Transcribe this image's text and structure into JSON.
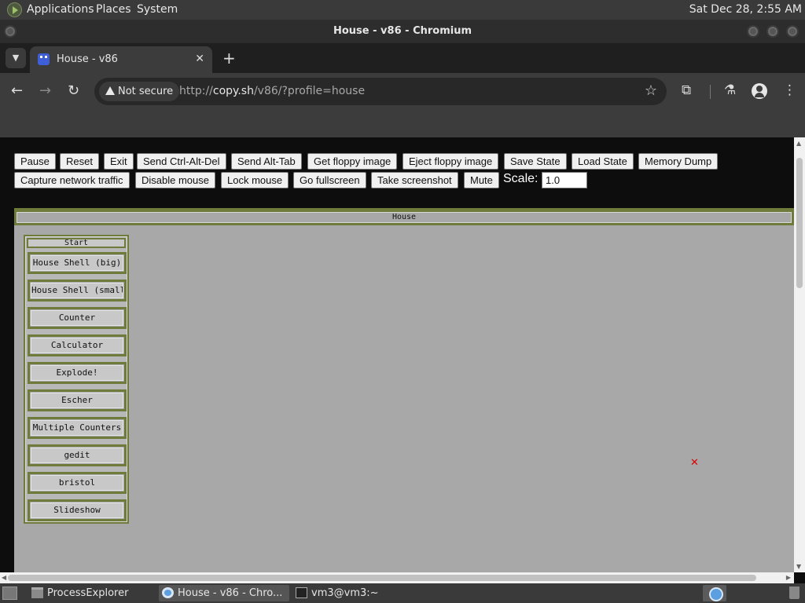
{
  "top_panel": {
    "menus": [
      "Applications",
      "Places",
      "System"
    ],
    "clock": "Sat Dec 28,  2:55 AM"
  },
  "window": {
    "title": "House - v86 - Chromium"
  },
  "browser": {
    "tab": {
      "title": "House - v86",
      "close": "✕"
    },
    "new_tab": "+",
    "security_label": "Not secure",
    "url": {
      "scheme": "http://",
      "host": "copy.sh",
      "path": "/v86/?profile=house"
    }
  },
  "v86": {
    "row1": [
      "Pause",
      "Reset",
      "Exit",
      "Send Ctrl-Alt-Del",
      "Send Alt-Tab",
      "Get floppy image",
      "Eject floppy image",
      "Save State",
      "Load State",
      "Memory Dump"
    ],
    "row2": [
      "Capture network traffic",
      "Disable mouse",
      "Lock mouse",
      "Go fullscreen",
      "Take screenshot",
      "Mute"
    ],
    "scale_label": "Scale:",
    "scale_value": "1.0"
  },
  "house": {
    "title": "House",
    "start_title": "Start",
    "buttons": [
      "House Shell (big)",
      "House Shell (small)",
      "Counter",
      "Calculator",
      "Explode!",
      "Escher",
      "Multiple Counters",
      "gedit",
      "bristol",
      "Slideshow"
    ]
  },
  "taskbar": {
    "tasks": [
      "ProcessExplorer",
      "House - v86 - Chro...",
      "vm3@vm3:~"
    ]
  }
}
